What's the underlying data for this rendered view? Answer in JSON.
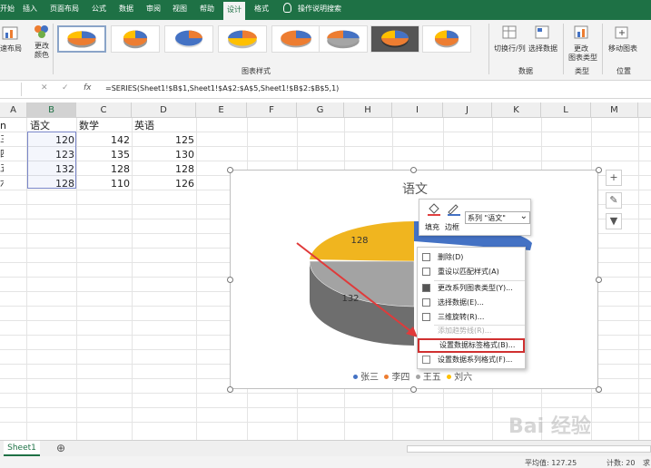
{
  "ribbon_tabs": [
    {
      "label": "开始",
      "active": false
    },
    {
      "label": "插入",
      "active": false
    },
    {
      "label": "页面布局",
      "active": false
    },
    {
      "label": "公式",
      "active": false
    },
    {
      "label": "数据",
      "active": false
    },
    {
      "label": "审阅",
      "active": false
    },
    {
      "label": "视图",
      "active": false
    },
    {
      "label": "帮助",
      "active": false
    },
    {
      "label": "设计",
      "active": true
    },
    {
      "label": "格式",
      "active": false
    }
  ],
  "tell_me": "操作说明搜索",
  "ribbon": {
    "quick_layout": "速布局",
    "change_colors": "更改",
    "change_colors_2": "颜色",
    "chart_styles": "图表样式",
    "switch_row_col": "切换行/列",
    "select_data": "选择数据",
    "data_group": "数据",
    "change_type": "更改",
    "change_type_2": "图表类型",
    "type_group": "类型",
    "move_chart": "移动图表",
    "location_group": "位置"
  },
  "formula_bar": {
    "cancel": "✕",
    "enter": "✓",
    "fx": "fx",
    "formula": "=SERIES(Sheet1!$B$1,Sheet1!$A$2:$A$5,Sheet1!$B$2:$B$5,1)"
  },
  "columns": [
    "A",
    "B",
    "C",
    "D",
    "E",
    "F",
    "G",
    "H",
    "I",
    "J",
    "K",
    "L",
    "M"
  ],
  "sheet": {
    "headers": {
      "a": "n",
      "b": "语文",
      "c": "数学",
      "d": "英语"
    },
    "rows": [
      {
        "a": "三",
        "b": "120",
        "c": "142",
        "d": "125"
      },
      {
        "a": "四",
        "b": "123",
        "c": "135",
        "d": "130"
      },
      {
        "a": "五",
        "b": "132",
        "c": "128",
        "d": "128"
      },
      {
        "a": "六",
        "b": "128",
        "c": "110",
        "d": "126"
      }
    ]
  },
  "chart": {
    "title": "语文",
    "data_labels": [
      "128",
      "132"
    ],
    "legend": [
      {
        "label": "张三",
        "color": "#4472c4"
      },
      {
        "label": "李四",
        "color": "#ed7d31"
      },
      {
        "label": "王五",
        "color": "#a5a5a5"
      },
      {
        "label": "刘六",
        "color": "#ffc000"
      }
    ],
    "side_buttons": [
      "+",
      "✎",
      "▼"
    ]
  },
  "mini_toolbar": {
    "fill": "填充",
    "outline": "边框",
    "series_select": "系列 \"语文\""
  },
  "context_menu": [
    {
      "label": "删除(D)",
      "disabled": false,
      "highlighted": false
    },
    {
      "label": "重设以匹配样式(A)",
      "disabled": false,
      "highlighted": false
    },
    {
      "label": "更改系列图表类型(Y)...",
      "disabled": false,
      "highlighted": false
    },
    {
      "label": "选择数据(E)...",
      "disabled": false,
      "highlighted": false
    },
    {
      "label": "三维旋转(R)...",
      "disabled": false,
      "highlighted": false
    },
    {
      "label": "添加趋势线(R)...",
      "disabled": true,
      "highlighted": false
    },
    {
      "label": "设置数据标签格式(B)...",
      "disabled": false,
      "highlighted": true
    },
    {
      "label": "设置数据系列格式(F)...",
      "disabled": false,
      "highlighted": false
    }
  ],
  "sheet_tabs": {
    "active": "Sheet1",
    "add": "⊕"
  },
  "status": {
    "average": "平均值: 127.25",
    "count": "计数: 20",
    "sum_partial": "求"
  },
  "watermark": "Bai 经验"
}
